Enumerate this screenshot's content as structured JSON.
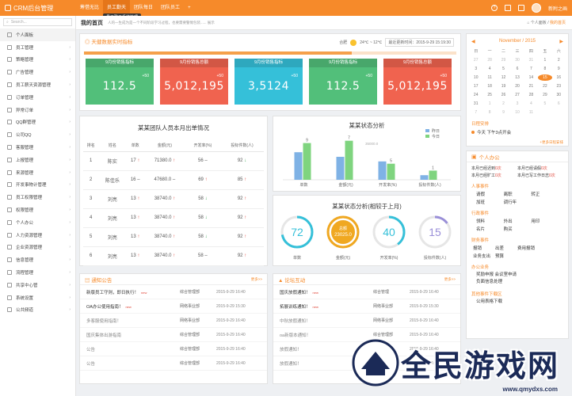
{
  "app": {
    "title": "CRM后台管理"
  },
  "topnav": [
    {
      "label": "筹借无比",
      "tooltip": ""
    },
    {
      "label": "员工勤天",
      "tooltip": "员工勤天系统管理"
    },
    {
      "label": "团队每日",
      "tooltip": ""
    },
    {
      "label": "团队员工",
      "tooltip": ""
    }
  ],
  "topnav_plus": "+",
  "user": {
    "name": "新附之画"
  },
  "sidebar": {
    "search_placeholder": "Search...",
    "items": [
      {
        "label": "个人面板"
      },
      {
        "label": "员工管理"
      },
      {
        "label": "策略管理"
      },
      {
        "label": "广告管理"
      },
      {
        "label": "员工薪天资源管理"
      },
      {
        "label": "订单管理"
      },
      {
        "label": "异常订单"
      },
      {
        "label": "QQ群管理"
      },
      {
        "label": "公司QQ"
      },
      {
        "label": "客服管理"
      },
      {
        "label": "上报管理"
      },
      {
        "label": "来源管理"
      },
      {
        "label": "开发事物计管理"
      },
      {
        "label": "员工权限管理"
      },
      {
        "label": "权限管理"
      },
      {
        "label": "个人办公"
      },
      {
        "label": "人力资源管理"
      },
      {
        "label": "企业资源管理"
      },
      {
        "label": "信息管理"
      },
      {
        "label": "流程管理"
      },
      {
        "label": "共享中心管"
      },
      {
        "label": "系统设置"
      },
      {
        "label": "公共频道"
      }
    ]
  },
  "header": {
    "page_title": "我的首页",
    "subtitle": "人的一生成为是一个不同阶段学习过程，也要需要警惕包装...... 展示",
    "breadcrumb": [
      "个人面板",
      "我的首页"
    ]
  },
  "kpi": {
    "title": "天健数据实时指标",
    "weather_city": "合肥",
    "weather_temp": "24℃ ~ 12℃",
    "date_label": "最近更新时间",
    "date_value": "2015-9-29 15:19:30",
    "progress": 0.72,
    "cards": [
      {
        "label": "9月份销售指标",
        "badge": "+50",
        "value": "112.5",
        "color": "#52bf7a"
      },
      {
        "label": "9月份销售总额",
        "badge": "+50",
        "value": "5,012,195",
        "color": "#f0634f"
      },
      {
        "label": "9月份销售指标",
        "badge": "+50",
        "value": "3,5124",
        "color": "#35c0d9"
      },
      {
        "label": "9月份销售指标",
        "badge": "+50",
        "value": "112.5",
        "color": "#52bf7a"
      },
      {
        "label": "9月份销售总额",
        "badge": "+50",
        "value": "5,012,195",
        "color": "#f0634f"
      }
    ]
  },
  "calendar": {
    "header": "November / 2015",
    "weekdays": [
      "日",
      "一",
      "二",
      "三",
      "四",
      "五",
      "六"
    ],
    "days": [
      "1",
      "2",
      "3",
      "4",
      "5",
      "6",
      "7",
      "8",
      "9",
      "10",
      "11",
      "12",
      "13",
      "14",
      "15",
      "16",
      "17",
      "18",
      "19",
      "20",
      "21",
      "22",
      "23",
      "24",
      "25",
      "26",
      "27",
      "28",
      "29",
      "30",
      "31",
      "1",
      "2",
      "3",
      "4",
      "5",
      "6",
      "7",
      "8",
      "9",
      "10",
      "11"
    ],
    "lead_days": [
      "27",
      "28",
      "29",
      "30",
      "31"
    ],
    "today": "15",
    "schedule_title": "日程安排",
    "schedule_item": "今天  下午3点开会",
    "more_label": "+更多日程安排"
  },
  "staff_table": {
    "title": "某某团队人员本月出单情况",
    "columns": [
      "排名",
      "姓名",
      "单数",
      "金额(元)",
      "开发率(%)",
      "投标件数(人)"
    ],
    "rows": [
      {
        "rank": "1",
        "name": "陈实",
        "orders": "17",
        "od": "up",
        "amount": "71380.0",
        "ad": "up",
        "rate": "56",
        "rd": "–",
        "bids": "92",
        "bd": "down"
      },
      {
        "rank": "2",
        "name": "陈佳乐",
        "orders": "16",
        "od": "–",
        "amount": "47680.0",
        "ad": "–",
        "rate": "69",
        "rd": "up",
        "bids": "85",
        "bd": "up"
      },
      {
        "rank": "3",
        "name": "刘亮",
        "orders": "13",
        "od": "up",
        "amount": "38740.0",
        "ad": "up",
        "rate": "58",
        "rd": "down",
        "bids": "92",
        "bd": "up"
      },
      {
        "rank": "4",
        "name": "刘亮",
        "orders": "13",
        "od": "up",
        "amount": "38740.0",
        "ad": "up",
        "rate": "58",
        "rd": "down",
        "bids": "92",
        "bd": "up"
      },
      {
        "rank": "5",
        "name": "刘亮",
        "orders": "13",
        "od": "up",
        "amount": "38740.0",
        "ad": "up",
        "rate": "58",
        "rd": "down",
        "bids": "92",
        "bd": "up"
      },
      {
        "rank": "6",
        "name": "刘亮",
        "orders": "13",
        "od": "up",
        "amount": "38740.0",
        "ad": "up",
        "rate": "58",
        "rd": "–",
        "bids": "92",
        "bd": "up"
      }
    ]
  },
  "status_chart": {
    "title": "某某状态分析",
    "legend": [
      "昨日",
      "今日"
    ],
    "annotation": "35000.0"
  },
  "chart_data": [
    {
      "type": "bar",
      "title": "某某状态分析",
      "categories": [
        "单数",
        "金额(元)",
        "开发率(%)",
        "投标件数(人)"
      ],
      "series": [
        {
          "name": "昨日",
          "values": [
            60,
            50,
            40,
            10
          ],
          "color": "#7fb2e5"
        },
        {
          "name": "今日",
          "values": [
            80,
            85,
            35,
            20
          ],
          "color": "#7fd47f"
        }
      ],
      "data_labels": [
        "9",
        "7",
        "5",
        "1"
      ],
      "ylim": [
        0,
        100
      ]
    },
    {
      "type": "pie",
      "title": "某某状态分析(相较于上月)",
      "gauges": [
        {
          "label": "单数",
          "value": 72,
          "display": "72",
          "color": "#35c0d9"
        },
        {
          "label": "金额(元)",
          "value": 100,
          "display": "23025.0",
          "color": "#f0a821",
          "caption": "总额"
        },
        {
          "label": "开发率(%)",
          "value": 40,
          "display": "40",
          "color": "#35c0d9"
        },
        {
          "label": "投标件数(人)",
          "value": 15,
          "display": "15",
          "color": "#9a8fd8"
        }
      ]
    }
  ],
  "personal": {
    "title": "个人办公",
    "stats": [
      {
        "label": "本月已经迟到",
        "value": "0次"
      },
      {
        "label": "本月已经请假",
        "value": "0次"
      },
      {
        "label": "本月已经旷工",
        "value": "0次"
      },
      {
        "label": "本月已写工作日志",
        "value": "0次"
      }
    ],
    "sections": [
      {
        "title": "人事事件",
        "cols": 3,
        "items": [
          "请假",
          "离职",
          "转正",
          "加班",
          "调行年",
          ""
        ]
      },
      {
        "title": "行政事件",
        "cols": 3,
        "items": [
          "领料",
          "外出",
          "用印",
          "名片",
          "购买",
          ""
        ]
      },
      {
        "title": "财务事件",
        "cols": 4,
        "items": [
          "报销",
          "出差",
          "费用报销",
          "",
          "业务支出",
          "预算",
          "",
          ""
        ]
      },
      {
        "title": "办公业务",
        "cols": 1,
        "items": [
          "奖励申报        会议室申请",
          "负面信息处理"
        ]
      },
      {
        "title": "其他事件下载区",
        "cols": 1,
        "items": [
          "公用表格下载"
        ]
      }
    ]
  },
  "notice": {
    "title": "通知公告",
    "more": "更多>>",
    "new_tag": "new",
    "rows": [
      {
        "title": "新版员工守则，即日执行！",
        "dept": "综合管理部",
        "time": "2015-9-29 16:40",
        "new": true,
        "dim": false
      },
      {
        "title": "OA办公使用指南！",
        "dept": "网络事业部",
        "time": "2015-9-29 15:30",
        "new": true,
        "dim": false
      },
      {
        "title": "多客服使用指南！",
        "dept": "网络事业部",
        "time": "2015-9-29 16:40",
        "new": false,
        "dim": true
      },
      {
        "title": "国庆集体出游指南",
        "dept": "综合管理部",
        "time": "2015-9-29 16:40",
        "new": false,
        "dim": true
      },
      {
        "title": "公告",
        "dept": "综合管理部",
        "time": "2015-9-29 16:40",
        "new": false,
        "dim": true
      },
      {
        "title": "公告",
        "dept": "综合管理部",
        "time": "2015-9-29 16:40",
        "new": false,
        "dim": true
      }
    ]
  },
  "forum": {
    "title": "论坛互动",
    "more": "更多>>",
    "new_tag": "new",
    "rows": [
      {
        "title": "国庆放假通知！",
        "dept": "综合管理",
        "time": "2015-9-29 16:40",
        "new": true,
        "dim": false
      },
      {
        "title": "拓展训练通知！",
        "dept": "网络事业部",
        "time": "2015-9-29 15:30",
        "new": true,
        "dim": false
      },
      {
        "title": "中秋放假通知！",
        "dept": "网络事业部",
        "time": "2015-9-29 16:40",
        "new": false,
        "dim": true
      },
      {
        "title": "oa新版本通知！",
        "dept": "综合管理部",
        "time": "2015-9-29 16:40",
        "new": false,
        "dim": true
      },
      {
        "title": "放假通知！",
        "dept": "综合管理部",
        "time": "2015-9-29 16:40",
        "new": false,
        "dim": true
      },
      {
        "title": "放假通知！",
        "dept": "综合管理部",
        "time": "2015-9-29 16:40",
        "new": false,
        "dim": true
      }
    ]
  },
  "watermark": {
    "text": "全民游戏网",
    "url": "www.qmydxs.com"
  }
}
